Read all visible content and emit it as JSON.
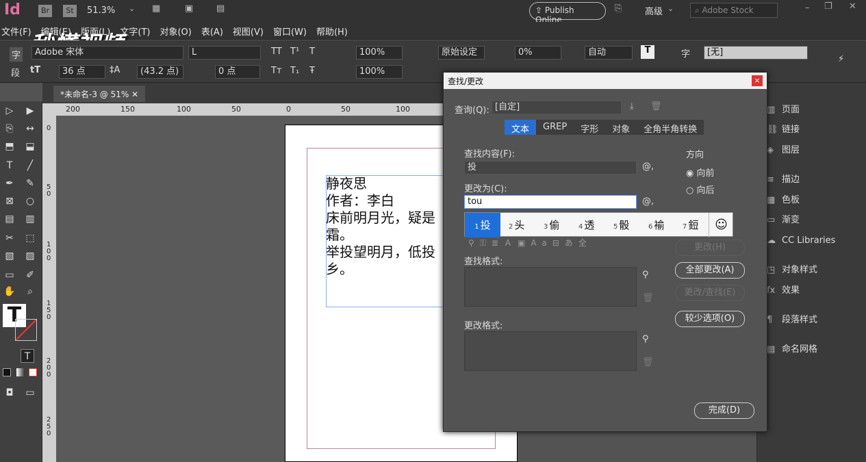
{
  "app": {
    "logo": "Id",
    "br": "Br",
    "st": "St",
    "zoom": "51.3%",
    "publish": "Publish Online",
    "workspace": "高级",
    "stock_placeholder": "Adobe Stock"
  },
  "menu": [
    "文件(F)",
    "编辑(E)",
    "版面(L)",
    "文字(T)",
    "对象(O)",
    "表(A)",
    "视图(V)",
    "窗口(W)",
    "帮助(H)"
  ],
  "watermark": "秒懂视频",
  "control": {
    "font": "Adobe 宋体",
    "style": "L",
    "size": "36 点",
    "leading": "(43.2 点)",
    "tracking_pts": "0 点",
    "scale_v": "100%",
    "scale_h": "100%",
    "kerning": "原始设定",
    "tracking": "0%",
    "auto": "自动",
    "char_style": "[无]",
    "char_label": "字",
    "para_label": "段"
  },
  "document": {
    "tab": "*未命名-3 @ 51%",
    "poem": [
      "静夜思",
      "作者：李白",
      "床前明月光，疑是",
      "霜。",
      "举投望明月，低投",
      "乡。"
    ]
  },
  "ruler_h": [
    "200",
    "150",
    "100",
    "50",
    "0",
    "50",
    "100"
  ],
  "ruler_v": [
    "0",
    "5 0",
    "1 0 0",
    "1 5 0",
    "2 0 0",
    "2 5 0"
  ],
  "dialog": {
    "title": "查找/更改",
    "query_label": "查询(Q):",
    "query_value": "[自定]",
    "tabs": [
      "文本",
      "GREP",
      "字形",
      "对象",
      "全角半角转换"
    ],
    "find_label": "查找内容(F):",
    "find_value": "投",
    "change_label": "更改为(C):",
    "change_value": "tou",
    "direction_label": "方向",
    "forward": "向前",
    "backward": "向后",
    "find_format": "查找格式:",
    "change_format": "更改格式:",
    "btn_change": "更改(H)",
    "btn_change_all": "全部更改(A)",
    "btn_change_find": "更改/查找(E)",
    "btn_fewer": "较少选项(O)",
    "btn_done": "完成(D)",
    "close": "×"
  },
  "ime": {
    "candidates": [
      {
        "n": "1",
        "t": "投"
      },
      {
        "n": "2",
        "t": "头"
      },
      {
        "n": "3",
        "t": "偷"
      },
      {
        "n": "4",
        "t": "透"
      },
      {
        "n": "5",
        "t": "骰"
      },
      {
        "n": "6",
        "t": "褕"
      },
      {
        "n": "7",
        "t": "鋀"
      }
    ],
    "emoji": "☺"
  },
  "panels": [
    {
      "icon": "▥",
      "label": "页面"
    },
    {
      "icon": "⛓",
      "label": "链接"
    },
    {
      "icon": "◈",
      "label": "图层"
    },
    {
      "icon": "≡",
      "label": "描边"
    },
    {
      "icon": "▦",
      "label": "色板"
    },
    {
      "icon": "▭",
      "label": "渐变"
    },
    {
      "icon": "☁",
      "label": "CC Libraries"
    },
    {
      "icon": "◳",
      "label": "对象样式"
    },
    {
      "icon": "fx",
      "label": "效果"
    },
    {
      "icon": "¶",
      "label": "段落样式"
    },
    {
      "icon": "▤",
      "label": "命名网格"
    }
  ]
}
